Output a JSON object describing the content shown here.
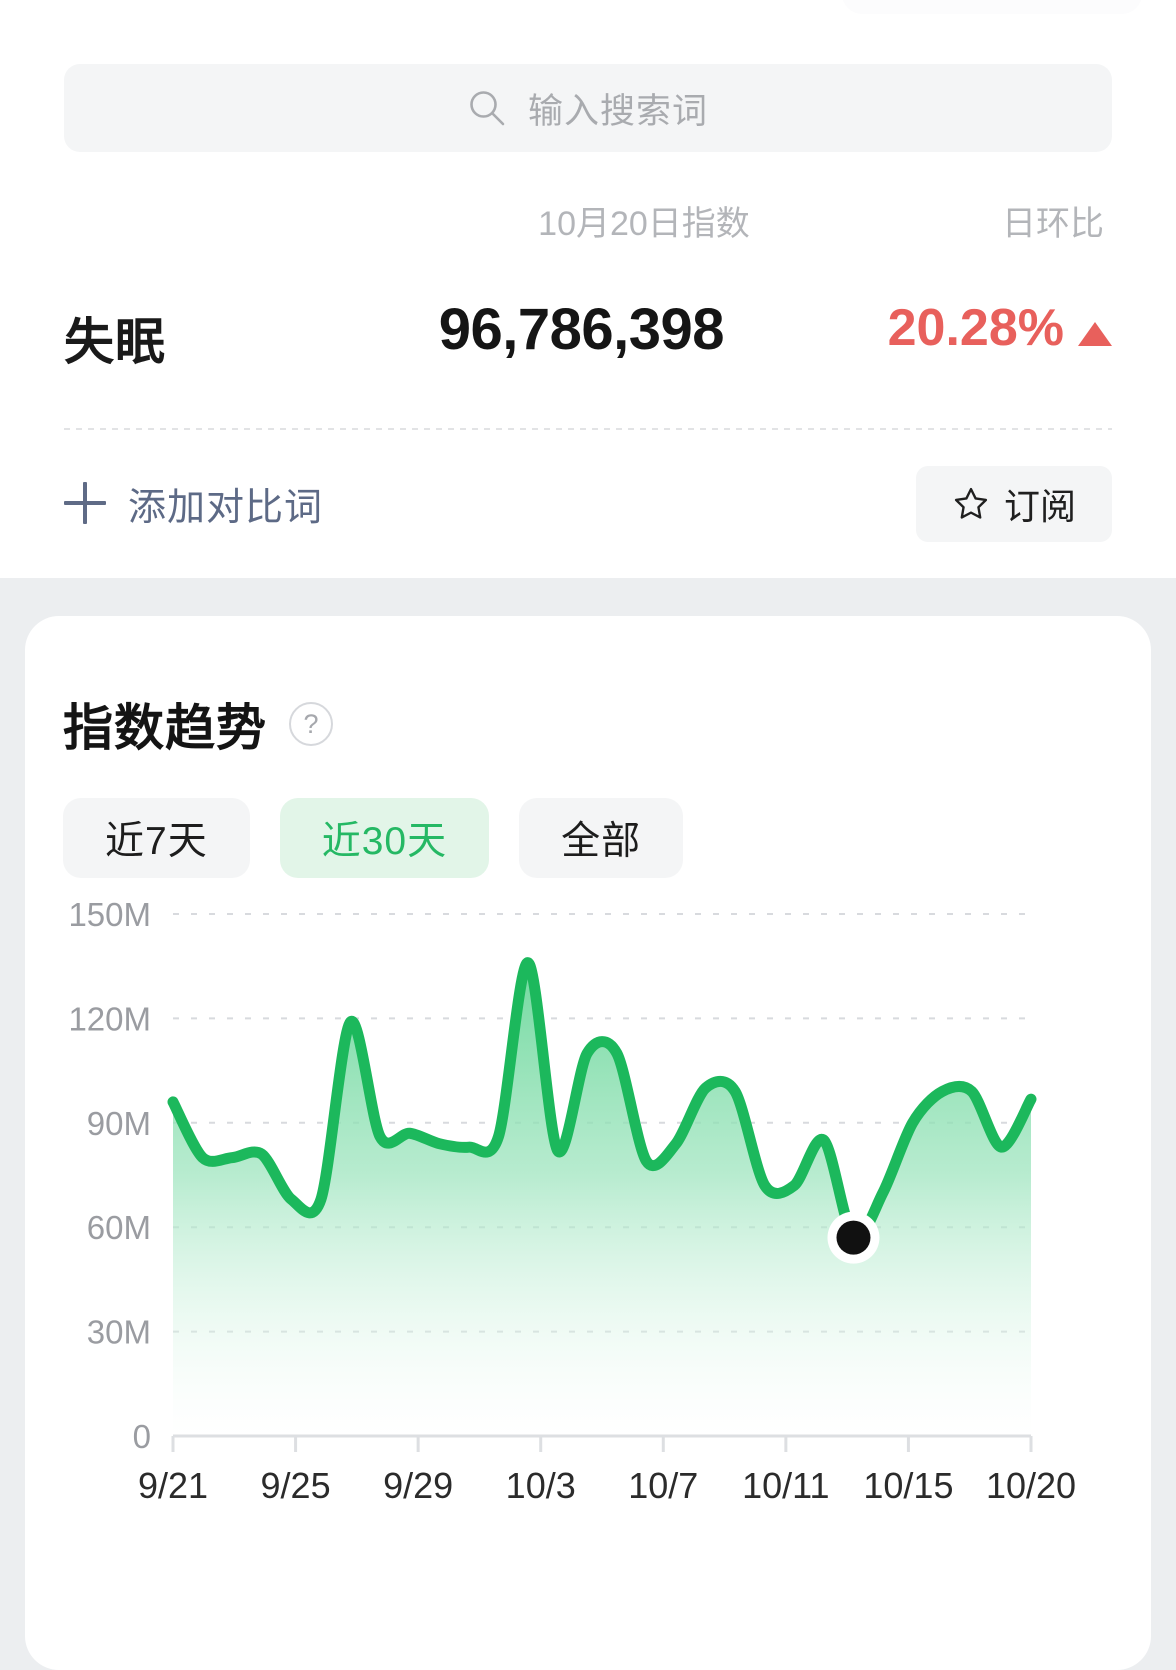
{
  "search": {
    "placeholder": "输入搜索词",
    "icon": "search-icon"
  },
  "header": {
    "index_label": "10月20日指数",
    "change_label": "日环比"
  },
  "keyword_row": {
    "keyword": "失眠",
    "index_value": "96,786,398",
    "change_value": "20.28%",
    "change_direction": "up",
    "change_color": "#e8605c"
  },
  "actions": {
    "add_compare_label": "添加对比词",
    "add_compare_icon": "plus-icon",
    "subscribe_label": "订阅",
    "subscribe_icon": "star-icon"
  },
  "trend_card": {
    "title": "指数趋势",
    "help_icon": "?",
    "tabs": [
      {
        "label": "近7天",
        "active": false
      },
      {
        "label": "近30天",
        "active": true
      },
      {
        "label": "全部",
        "active": false
      }
    ],
    "accent_color": "#25b864"
  },
  "chart_data": {
    "type": "area",
    "title": "指数趋势",
    "xlabel": "",
    "ylabel": "",
    "ylim": [
      0,
      150000000
    ],
    "y_ticks": [
      0,
      30000000,
      60000000,
      90000000,
      120000000,
      150000000
    ],
    "y_tick_labels": [
      "0",
      "30M",
      "60M",
      "90M",
      "120M",
      "150M"
    ],
    "x_tick_labels": [
      "9/21",
      "9/25",
      "9/29",
      "10/3",
      "10/7",
      "10/11",
      "10/15",
      "10/20"
    ],
    "grid": true,
    "legend": "none",
    "line_color": "#1cb85c",
    "fill_gradient": [
      "#6fd99b",
      "#ffffff"
    ],
    "marker": {
      "label": "10/14",
      "value": 57000000,
      "color": "#111111",
      "ring_color": "#ffffff"
    },
    "categories": [
      "9/21",
      "9/22",
      "9/23",
      "9/24",
      "9/25",
      "9/26",
      "9/27",
      "9/28",
      "9/29",
      "9/30",
      "10/1",
      "10/2",
      "10/3",
      "10/4",
      "10/5",
      "10/6",
      "10/7",
      "10/8",
      "10/9",
      "10/10",
      "10/11",
      "10/12",
      "10/13",
      "10/14",
      "10/15",
      "10/16",
      "10/17",
      "10/18",
      "10/19",
      "10/20"
    ],
    "values": [
      96000000,
      80000000,
      80000000,
      81000000,
      68000000,
      68000000,
      119000000,
      86000000,
      87000000,
      84000000,
      83000000,
      86000000,
      136000000,
      82000000,
      110000000,
      110000000,
      79000000,
      84000000,
      100000000,
      99000000,
      72000000,
      72000000,
      85000000,
      57000000,
      70000000,
      90000000,
      99000000,
      99000000,
      83000000,
      96786398
    ]
  }
}
